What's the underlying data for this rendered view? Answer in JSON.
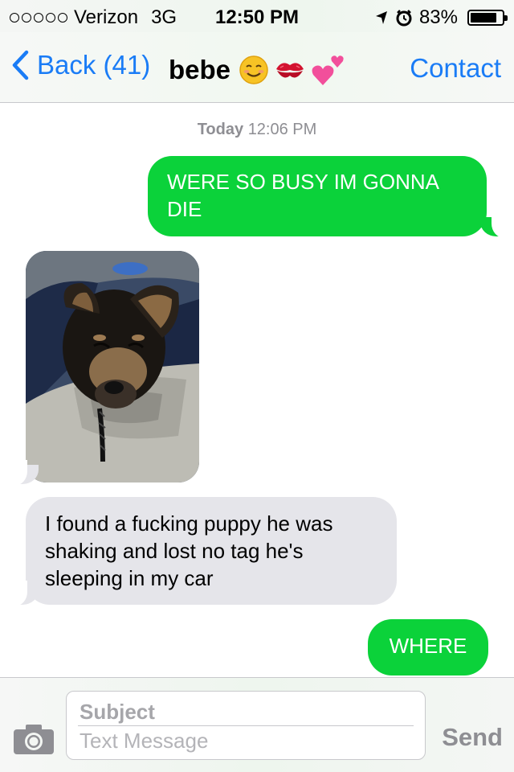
{
  "status_bar": {
    "carrier": "Verizon",
    "network": "3G",
    "time": "12:50 PM",
    "battery": "83%",
    "battery_level": 0.83,
    "icons": [
      "signal-dots-icon",
      "location-arrow-icon",
      "alarm-icon",
      "battery-icon"
    ]
  },
  "nav": {
    "back_label": "Back (41)",
    "contact_name": "bebe",
    "contact_emojis": [
      "☺️",
      "💋",
      "💕"
    ],
    "contact_button": "Contact"
  },
  "thread": {
    "timestamp_day": "Today",
    "timestamp_time": "12:06 PM",
    "messages": [
      {
        "direction": "outgoing",
        "text": "WERE SO BUSY IM GONNA DIE"
      },
      {
        "direction": "incoming",
        "type": "photo",
        "description": "puppy"
      },
      {
        "direction": "incoming",
        "text": "I found a fucking puppy he was shaking and lost no tag he's sleeping in my car"
      },
      {
        "direction": "outgoing",
        "text": "WHERE"
      }
    ]
  },
  "composer": {
    "subject_placeholder": "Subject",
    "message_placeholder": "Text Message",
    "send_label": "Send"
  },
  "colors": {
    "accent_blue": "#1a7cf6",
    "outgoing_bubble": "#0bd23a",
    "incoming_bubble": "#e5e5ea"
  }
}
